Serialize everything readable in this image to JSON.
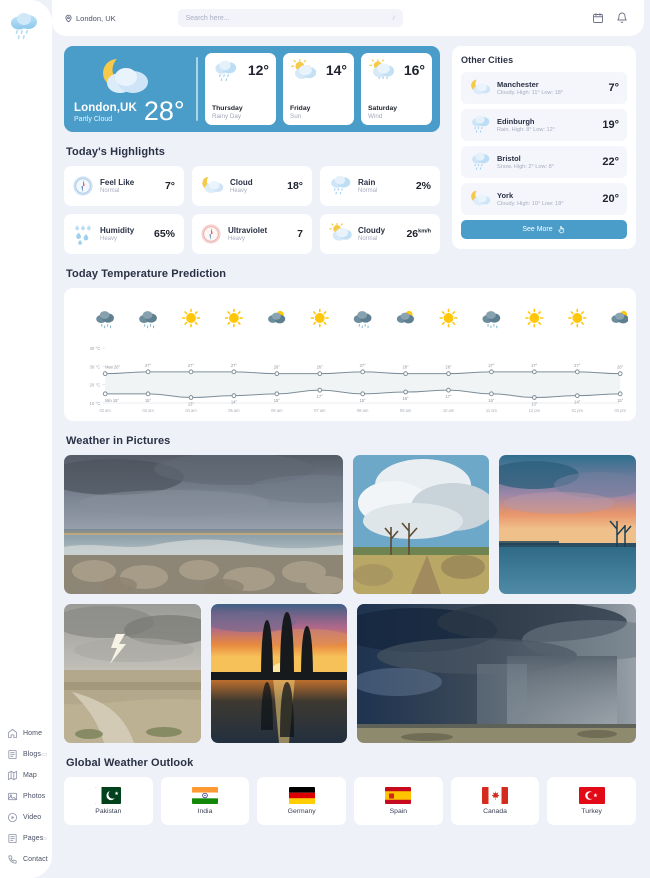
{
  "brand": {
    "logo_icon": "rain-cloud-logo"
  },
  "sidebar": {
    "items": [
      {
        "label": "Home",
        "icon": "home-icon",
        "caret": ""
      },
      {
        "label": "Blogs",
        "icon": "blogs-icon",
        "caret": "▭"
      },
      {
        "label": "Map",
        "icon": "map-icon",
        "caret": ""
      },
      {
        "label": "Photos",
        "icon": "photos-icon",
        "caret": ""
      },
      {
        "label": "Video",
        "icon": "video-icon",
        "caret": ""
      },
      {
        "label": "Pages",
        "icon": "pages-icon",
        "caret": "▭"
      },
      {
        "label": "Contact",
        "icon": "contact-icon",
        "caret": ""
      }
    ]
  },
  "header": {
    "location": "London, UK",
    "location_icon": "map-pin-icon",
    "search_placeholder": "Search here...",
    "search_value": "",
    "search_shortcut": "/",
    "calendar_icon": "calendar-icon",
    "bell_icon": "bell-icon"
  },
  "hero": {
    "city": "London,UK",
    "condition": "Partly Cloud",
    "temperature": "28°",
    "icon": "moon-cloud-icon",
    "forecast": [
      {
        "day": "Thursday",
        "sub": "Rainy Day",
        "temp": "12°",
        "icon": "rain-icon"
      },
      {
        "day": "Friday",
        "sub": "Sun",
        "temp": "14°",
        "icon": "sun-cloud-icon"
      },
      {
        "day": "Saturday",
        "sub": "Wind",
        "temp": "16°",
        "icon": "sun-cloud-rain-icon"
      }
    ]
  },
  "other_cities": {
    "title": "Other Cities",
    "see_more_label": "See More",
    "see_more_icon": "pointer-hand-icon",
    "items": [
      {
        "name": "Manchester",
        "sub": "Cloudy. High: 11° Low: 18°",
        "temp": "7°",
        "icon": "moon-cloud-icon"
      },
      {
        "name": "Edinburgh",
        "sub": "Rain. High: 8° Low: 12°",
        "temp": "19°",
        "icon": "rain-icon"
      },
      {
        "name": "Bristol",
        "sub": "Snow. High: 2° Low: 8°",
        "temp": "22°",
        "icon": "rain-icon"
      },
      {
        "name": "York",
        "sub": "Cloudy. High: 10° Low: 18°",
        "temp": "20°",
        "icon": "moon-cloud-icon"
      }
    ]
  },
  "highlights": {
    "title": "Today's Highlights",
    "items": [
      {
        "name": "Feel Like",
        "sub": "Normal",
        "value": "7°",
        "unit": "",
        "icon": "compass-blue-icon"
      },
      {
        "name": "Cloud",
        "sub": "Heavy",
        "value": "18°",
        "unit": "",
        "icon": "moon-cloud-icon"
      },
      {
        "name": "Rain",
        "sub": "Normal",
        "value": "2%",
        "unit": "",
        "icon": "rain-icon"
      },
      {
        "name": "Humidity",
        "sub": "Heavy",
        "value": "65%",
        "unit": "",
        "icon": "droplets-icon"
      },
      {
        "name": "Ultraviolet",
        "sub": "Heavy",
        "value": "7",
        "unit": "",
        "icon": "compass-red-icon"
      },
      {
        "name": "Cloudy",
        "sub": "Normal",
        "value": "26",
        "unit": "km/h",
        "icon": "sun-cloud-icon"
      }
    ]
  },
  "chart_section": {
    "title": "Today Temperature Prediction"
  },
  "chart_data": {
    "type": "area",
    "title": "Today Temperature Prediction",
    "xlabel": "",
    "ylabel": "",
    "ylim": [
      10,
      40
    ],
    "grid": false,
    "legend": "none",
    "yticks": [
      "40 °C",
      "30 °C",
      "20 °C",
      "10 °C"
    ],
    "ytick_values": [
      40,
      30,
      20,
      10
    ],
    "categories": [
      "02 am",
      "03 am",
      "04 am",
      "05 am",
      "06 am",
      "07 am",
      "08 am",
      "09 am",
      "10 am",
      "11 am",
      "12 pm",
      "01 pm",
      "02 pm"
    ],
    "weather_icons": [
      "rain",
      "rain",
      "sun",
      "sun",
      "cloud-sun",
      "sun",
      "rain",
      "cloud-sun",
      "sun",
      "rain",
      "sun",
      "sun",
      "cloud-sun"
    ],
    "series": [
      {
        "name": "Max",
        "first_label": "Max 26°",
        "values": [
          26,
          27,
          27,
          27,
          26,
          26,
          27,
          26,
          26,
          27,
          27,
          27,
          26
        ],
        "point_labels": [
          "Max 26°",
          "27°",
          "27°",
          "27°",
          "26°",
          "26°",
          "27°",
          "26°",
          "26°",
          "27°",
          "27°",
          "27°",
          "26°"
        ]
      },
      {
        "name": "Min",
        "first_label": "Min 15°",
        "values": [
          15,
          15,
          13,
          14,
          15,
          17,
          15,
          16,
          17,
          15,
          13,
          14,
          15
        ],
        "point_labels": [
          "Min 15°",
          "15°",
          "13°",
          "14°",
          "15°",
          "17°",
          "15°",
          "16°",
          "17°",
          "15°",
          "13°",
          "14°",
          "15°"
        ]
      }
    ],
    "line_color": "#7e8e99",
    "fill_color": "#eef3f4"
  },
  "pictures": {
    "title": "Weather in Pictures",
    "items": [
      {
        "alt": "stormy-sky-over-rocky-beach"
      },
      {
        "alt": "cumulus-clouds-over-country-road"
      },
      {
        "alt": "pink-sunset-over-snow-field"
      },
      {
        "alt": "lightning-strike-over-farmland"
      },
      {
        "alt": "orange-sunset-reflected-on-lake"
      },
      {
        "alt": "dark-rain-storm-over-plain"
      }
    ]
  },
  "global": {
    "title": "Global Weather Outlook",
    "countries": [
      {
        "name": "Pakistan",
        "flag": "pk"
      },
      {
        "name": "India",
        "flag": "in"
      },
      {
        "name": "Germany",
        "flag": "de"
      },
      {
        "name": "Spain",
        "flag": "es"
      },
      {
        "name": "Canada",
        "flag": "ca"
      },
      {
        "name": "Turkey",
        "flag": "tr"
      }
    ]
  },
  "colors": {
    "accent": "#4a9dc9",
    "page_bg": "#eef1f8",
    "card_bg": "#ffffff",
    "muted_text": "#a8adbe",
    "heading_text": "#2b3145"
  }
}
